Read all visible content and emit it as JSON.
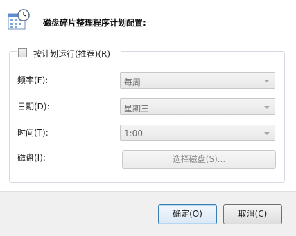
{
  "dialog": {
    "title": "磁盘碎片整理程序计划配置:",
    "icon": "calendar-clock-icon"
  },
  "schedule": {
    "run_on_schedule_label": "按计划运行(推荐)(R)",
    "run_on_schedule_checked": false,
    "frequency_label": "频率(F):",
    "frequency_value": "每周",
    "day_label": "日期(D):",
    "day_value": "星期三",
    "time_label": "时间(T):",
    "time_value": "1:00",
    "disks_label": "磁盘(I):",
    "select_disks_button": "选择磁盘(S)..."
  },
  "footer": {
    "ok_label": "确定(O)",
    "cancel_label": "取消(C)"
  },
  "colors": {
    "ok_border": "#3c7fb1",
    "disabled_text": "#6d6d6d",
    "footer_bg": "#f0f0f0"
  }
}
